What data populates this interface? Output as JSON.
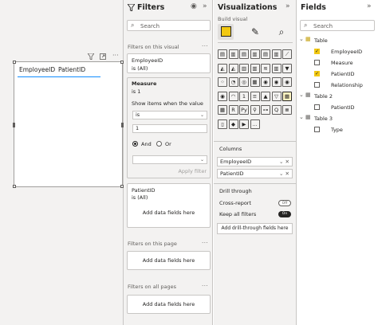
{
  "colors": {
    "accent": "#118dff",
    "check": "#f2c811",
    "pane_bg": "#f3f2f1",
    "border": "#c8c6c4"
  },
  "canvas": {
    "visual_headers": [
      "EmployeeID",
      "PatientID"
    ],
    "header_icons": [
      "filter-icon",
      "focus-mode-icon",
      "more-options-icon"
    ]
  },
  "filters": {
    "title": "Filters",
    "search_placeholder": "Search",
    "section_visual": "Filters on this visual",
    "employee_card": {
      "name": "EmployeeID",
      "value": "is (All)"
    },
    "measure_card": {
      "name": "Measure",
      "value": "is 1",
      "show_items_label": "Show items when the value",
      "operator": "is",
      "operand": "1",
      "and_label": "And",
      "or_label": "Or",
      "apply_label": "Apply filter"
    },
    "patient_card": {
      "name": "PatientID",
      "value": "is (All)"
    },
    "add_fields": "Add data fields here",
    "section_page": "Filters on this page",
    "section_all": "Filters on all pages"
  },
  "visualizations": {
    "title": "Visualizations",
    "build_label": "Build visual",
    "columns_label": "Columns",
    "columns": [
      "EmployeeID",
      "PatientID"
    ],
    "drill_label": "Drill through",
    "cross_report_label": "Cross-report",
    "cross_report_state": "Off",
    "keep_filters_label": "Keep all filters",
    "keep_filters_state": "On",
    "add_drill": "Add drill-through fields here",
    "grid_icons": [
      "stacked-bar-icon",
      "stacked-column-icon",
      "clustered-bar-icon",
      "clustered-column-icon",
      "100-bar-icon",
      "100-column-icon",
      "line-chart-icon",
      "area-chart-icon",
      "stacked-area-icon",
      "line-column-icon",
      "line-clustered-icon",
      "ribbon-icon",
      "waterfall-icon",
      "funnel-icon",
      "scatter-icon",
      "pie-icon",
      "donut-icon",
      "treemap-icon",
      "map-icon",
      "filled-map-icon",
      "shape-map-icon",
      "azure-map-icon",
      "gauge-icon",
      "card-icon",
      "multirow-card-icon",
      "kpi-icon",
      "slicer-icon",
      "table-icon",
      "matrix-icon",
      "r-visual-icon",
      "python-visual-icon",
      "key-influencers-icon",
      "decomposition-tree-icon",
      "qa-icon",
      "narrative-icon",
      "paginated-icon",
      "power-apps-icon",
      "power-automate-icon",
      "more-visuals-icon"
    ],
    "grid_glyphs": [
      "▤",
      "▥",
      "▤",
      "▥",
      "▤",
      "▥",
      "⟋",
      "◭",
      "◭",
      "▥",
      "▥",
      "≋",
      "▥",
      "▼",
      "⁘",
      "◔",
      "◎",
      "▦",
      "◉",
      "◉",
      "◉",
      "◉",
      "◠",
      "1",
      "≡",
      "▲",
      "▽",
      "▦",
      "▦",
      "R",
      "Py",
      "⚲",
      "⊶",
      "Q",
      "≣",
      "▯",
      "◆",
      "▶",
      "…"
    ]
  },
  "fields": {
    "title": "Fields",
    "search_placeholder": "Search",
    "tables": [
      {
        "name": "Table",
        "fields": [
          {
            "name": "EmployeeID",
            "checked": true
          },
          {
            "name": "Measure",
            "checked": false
          },
          {
            "name": "PatientID",
            "checked": true
          },
          {
            "name": "Relationship",
            "checked": false
          }
        ]
      },
      {
        "name": "Table 2",
        "fields": [
          {
            "name": "PatientID",
            "checked": false
          }
        ]
      },
      {
        "name": "Table 3",
        "fields": [
          {
            "name": "Type",
            "checked": false
          }
        ]
      }
    ]
  }
}
